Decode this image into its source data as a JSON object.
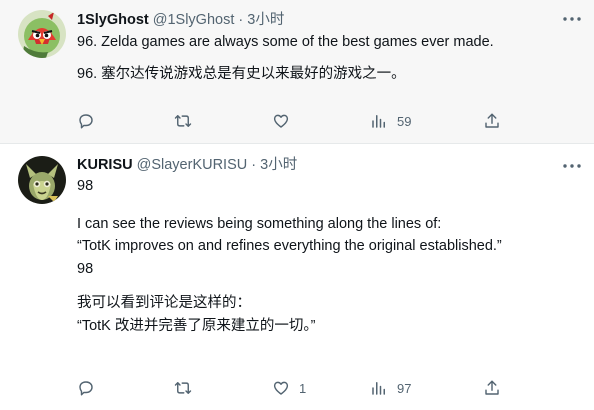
{
  "tweets": [
    {
      "display_name": "1SlyGhost",
      "handle": "@1SlyGhost",
      "separator": "·",
      "time": "3小时",
      "avatar_icon": "angry-bird-avatar",
      "lines": [
        "96. Zelda games are always some of the best games ever made.",
        "96. 塞尔达传说游戏总是有史以来最好的游戏之一。"
      ],
      "actions": {
        "reply": "",
        "retweet": "",
        "like": "",
        "views": "59"
      }
    },
    {
      "display_name": "KURISU",
      "handle": "@SlayerKURISU",
      "separator": "·",
      "time": "3小时",
      "avatar_icon": "creature-avatar",
      "lines": [
        "98",
        "",
        "I can see the reviews being something along the lines of:",
        "“TotK improves on and refines everything the original established.”",
        "",
        "98",
        "",
        "我可以看到评论是这样的：",
        "“TotK 改进并完善了原来建立的一切。”"
      ],
      "actions": {
        "reply": "",
        "retweet": "",
        "like": "1",
        "views": "97"
      }
    }
  ],
  "colors": {
    "text_primary": "#0f1419",
    "text_secondary": "#536471",
    "highlight_bg": "#f7f7f7",
    "divider": "#e6e9ea"
  },
  "icons": [
    "more-icon",
    "reply-icon",
    "retweet-icon",
    "like-icon",
    "views-icon",
    "share-icon"
  ]
}
